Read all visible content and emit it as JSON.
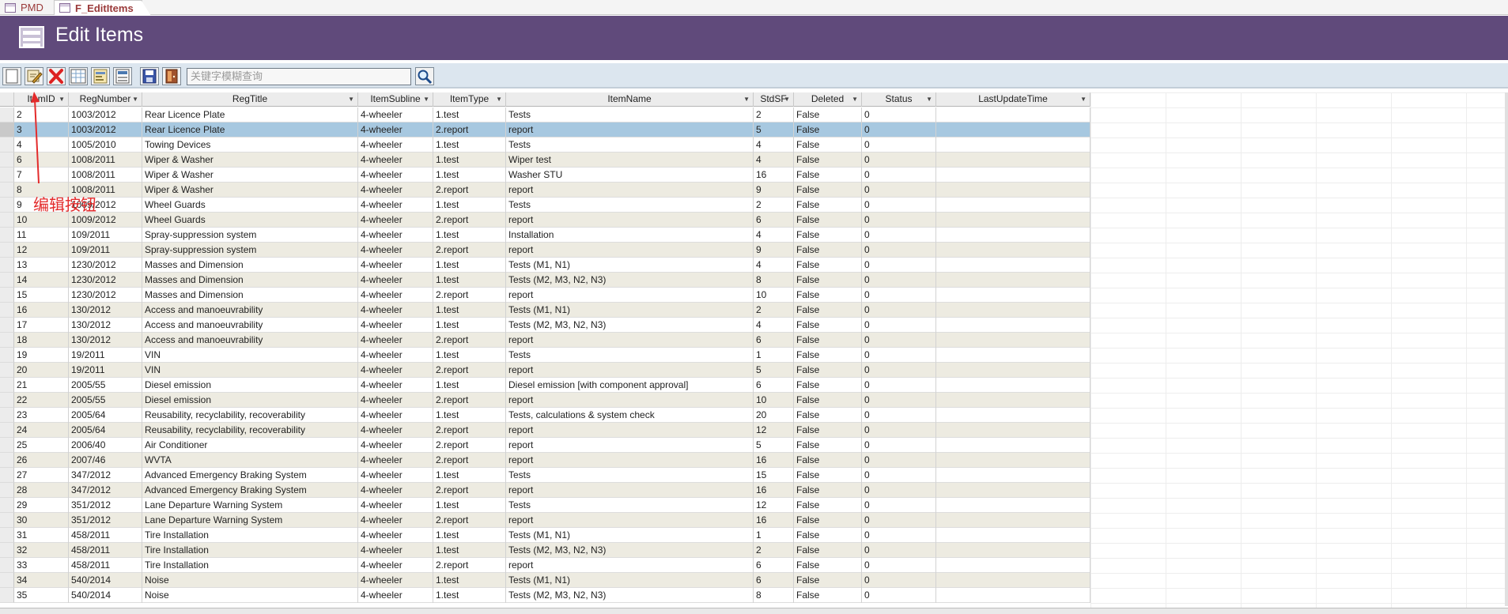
{
  "tabs": [
    {
      "label": "PMD"
    },
    {
      "label": "F_EditItems"
    }
  ],
  "header": {
    "title": "Edit Items"
  },
  "toolbar": {
    "buttons": [
      "new-record",
      "edit",
      "delete",
      "grid-view",
      "form-view",
      "report-view",
      "save",
      "exit"
    ],
    "search_placeholder": "关键字模糊查询"
  },
  "annotation": {
    "label": "编辑按钮",
    "color": "#e32b2b"
  },
  "columns": [
    "ItemID",
    "RegNumber",
    "RegTitle",
    "ItemSubline",
    "ItemType",
    "ItemName",
    "StdSF",
    "Deleted",
    "Status",
    "LastUpdateTime"
  ],
  "rows": [
    [
      "2",
      "1003/2012",
      "Rear Licence Plate",
      "4-wheeler",
      "1.test",
      "Tests",
      "2",
      "False",
      "0",
      ""
    ],
    [
      "3",
      "1003/2012",
      "Rear Licence Plate",
      "4-wheeler",
      "2.report",
      "report",
      "5",
      "False",
      "0",
      ""
    ],
    [
      "4",
      "1005/2010",
      "Towing Devices",
      "4-wheeler",
      "1.test",
      "Tests",
      "4",
      "False",
      "0",
      ""
    ],
    [
      "6",
      "1008/2011",
      "Wiper & Washer",
      "4-wheeler",
      "1.test",
      "Wiper test",
      "4",
      "False",
      "0",
      ""
    ],
    [
      "7",
      "1008/2011",
      "Wiper & Washer",
      "4-wheeler",
      "1.test",
      "Washer STU",
      "16",
      "False",
      "0",
      ""
    ],
    [
      "8",
      "1008/2011",
      "Wiper & Washer",
      "4-wheeler",
      "2.report",
      "report",
      "9",
      "False",
      "0",
      ""
    ],
    [
      "9",
      "1009/2012",
      "Wheel Guards",
      "4-wheeler",
      "1.test",
      "Tests",
      "2",
      "False",
      "0",
      ""
    ],
    [
      "10",
      "1009/2012",
      "Wheel Guards",
      "4-wheeler",
      "2.report",
      "report",
      "6",
      "False",
      "0",
      ""
    ],
    [
      "11",
      "109/2011",
      "Spray-suppression system",
      "4-wheeler",
      "1.test",
      "Installation",
      "4",
      "False",
      "0",
      ""
    ],
    [
      "12",
      "109/2011",
      "Spray-suppression system",
      "4-wheeler",
      "2.report",
      "report",
      "9",
      "False",
      "0",
      ""
    ],
    [
      "13",
      "1230/2012",
      "Masses and Dimension",
      "4-wheeler",
      "1.test",
      "Tests (M1, N1)",
      "4",
      "False",
      "0",
      ""
    ],
    [
      "14",
      "1230/2012",
      "Masses and Dimension",
      "4-wheeler",
      "1.test",
      "Tests (M2, M3, N2, N3)",
      "8",
      "False",
      "0",
      ""
    ],
    [
      "15",
      "1230/2012",
      "Masses and Dimension",
      "4-wheeler",
      "2.report",
      "report",
      "10",
      "False",
      "0",
      ""
    ],
    [
      "16",
      "130/2012",
      "Access and manoeuvrability",
      "4-wheeler",
      "1.test",
      "Tests (M1, N1)",
      "2",
      "False",
      "0",
      ""
    ],
    [
      "17",
      "130/2012",
      "Access and manoeuvrability",
      "4-wheeler",
      "1.test",
      "Tests (M2, M3, N2, N3)",
      "4",
      "False",
      "0",
      ""
    ],
    [
      "18",
      "130/2012",
      "Access and manoeuvrability",
      "4-wheeler",
      "2.report",
      "report",
      "6",
      "False",
      "0",
      ""
    ],
    [
      "19",
      "19/2011",
      "VIN",
      "4-wheeler",
      "1.test",
      "Tests",
      "1",
      "False",
      "0",
      ""
    ],
    [
      "20",
      "19/2011",
      "VIN",
      "4-wheeler",
      "2.report",
      "report",
      "5",
      "False",
      "0",
      ""
    ],
    [
      "21",
      "2005/55",
      "Diesel emission",
      "4-wheeler",
      "1.test",
      "Diesel emission [with component approval]",
      "6",
      "False",
      "0",
      ""
    ],
    [
      "22",
      "2005/55",
      "Diesel emission",
      "4-wheeler",
      "2.report",
      "report",
      "10",
      "False",
      "0",
      ""
    ],
    [
      "23",
      "2005/64",
      "Reusability, recyclability, recoverability",
      "4-wheeler",
      "1.test",
      "Tests, calculations & system check",
      "20",
      "False",
      "0",
      ""
    ],
    [
      "24",
      "2005/64",
      "Reusability, recyclability, recoverability",
      "4-wheeler",
      "2.report",
      "report",
      "12",
      "False",
      "0",
      ""
    ],
    [
      "25",
      "2006/40",
      "Air Conditioner",
      "4-wheeler",
      "2.report",
      "report",
      "5",
      "False",
      "0",
      ""
    ],
    [
      "26",
      "2007/46",
      "WVTA",
      "4-wheeler",
      "2.report",
      "report",
      "16",
      "False",
      "0",
      ""
    ],
    [
      "27",
      "347/2012",
      "Advanced Emergency Braking System",
      "4-wheeler",
      "1.test",
      "Tests",
      "15",
      "False",
      "0",
      ""
    ],
    [
      "28",
      "347/2012",
      "Advanced Emergency Braking System",
      "4-wheeler",
      "2.report",
      "report",
      "16",
      "False",
      "0",
      ""
    ],
    [
      "29",
      "351/2012",
      "Lane Departure Warning System",
      "4-wheeler",
      "1.test",
      "Tests",
      "12",
      "False",
      "0",
      ""
    ],
    [
      "30",
      "351/2012",
      "Lane Departure Warning System",
      "4-wheeler",
      "2.report",
      "report",
      "16",
      "False",
      "0",
      ""
    ],
    [
      "31",
      "458/2011",
      "Tire Installation",
      "4-wheeler",
      "1.test",
      "Tests (M1, N1)",
      "1",
      "False",
      "0",
      ""
    ],
    [
      "32",
      "458/2011",
      "Tire Installation",
      "4-wheeler",
      "1.test",
      "Tests (M2, M3, N2, N3)",
      "2",
      "False",
      "0",
      ""
    ],
    [
      "33",
      "458/2011",
      "Tire Installation",
      "4-wheeler",
      "2.report",
      "report",
      "6",
      "False",
      "0",
      ""
    ],
    [
      "34",
      "540/2014",
      "Noise",
      "4-wheeler",
      "1.test",
      "Tests (M1, N1)",
      "6",
      "False",
      "0",
      ""
    ],
    [
      "35",
      "540/2014",
      "Noise",
      "4-wheeler",
      "1.test",
      "Tests (M2, M3, N2, N3)",
      "8",
      "False",
      "0",
      ""
    ]
  ],
  "selected_row": 1,
  "colors": {
    "banner": "#604a7b",
    "selected_row": "#a7c8e0",
    "alt_row": "#edebe1",
    "annotation": "#e32b2b"
  }
}
